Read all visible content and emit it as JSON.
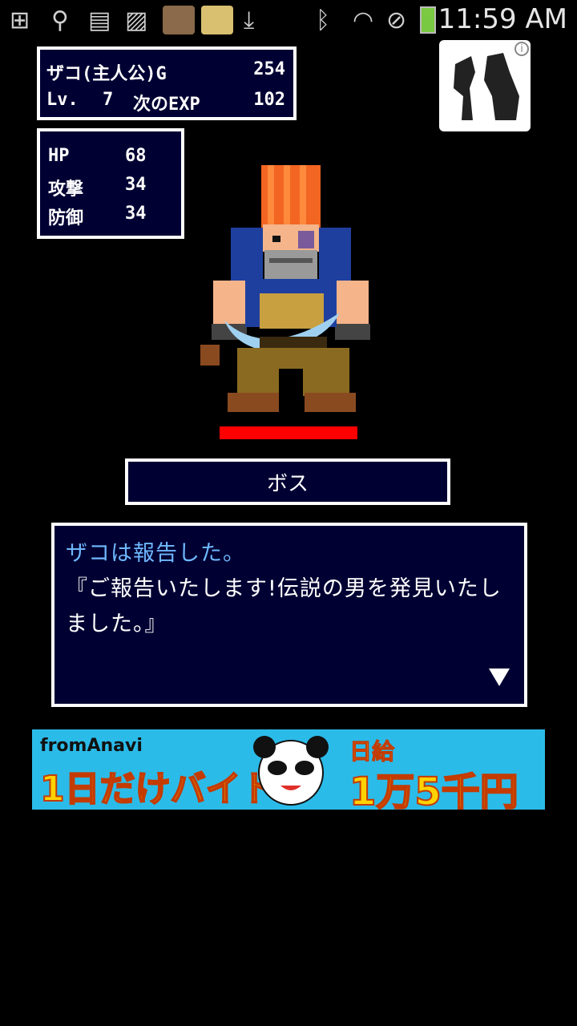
{
  "status_bar": {
    "time": "11:59 AM",
    "icons": [
      "add-icon",
      "usb-icon",
      "sd-card-icon",
      "image-icon",
      "app-thumbnail-icon",
      "app-thumbnail-icon",
      "download-icon",
      "bluetooth-icon",
      "wifi-icon",
      "do-not-disturb-icon",
      "battery-charging-icon"
    ]
  },
  "player": {
    "gold_label": "ザコ(主人公)G",
    "gold": "254",
    "level_label": "Lv.",
    "level": "7",
    "next_exp_label": "次のEXP",
    "next_exp": "102",
    "stats": [
      {
        "label": "HP",
        "value": "68"
      },
      {
        "label": "攻撃",
        "value": "34"
      },
      {
        "label": "防御",
        "value": "34"
      }
    ]
  },
  "enemy": {
    "name": "ボス",
    "hp_fraction": 1.0,
    "hp_color": "#ff0000"
  },
  "message": {
    "speaker_line": "ザコは報告した。",
    "line1": "『ご報告いたします!伝説の男を発見いたし",
    "line2": "ました。』",
    "speaker_color": "#6fb8ff"
  },
  "ad_banner": {
    "brand": "fromAnavi",
    "headline": "1日だけバイト",
    "sub": "日給",
    "price": "1万5千円",
    "bg_color": "#2bbbe9"
  },
  "colors": {
    "panel_bg": "#000033",
    "panel_border": "#ffffff"
  }
}
